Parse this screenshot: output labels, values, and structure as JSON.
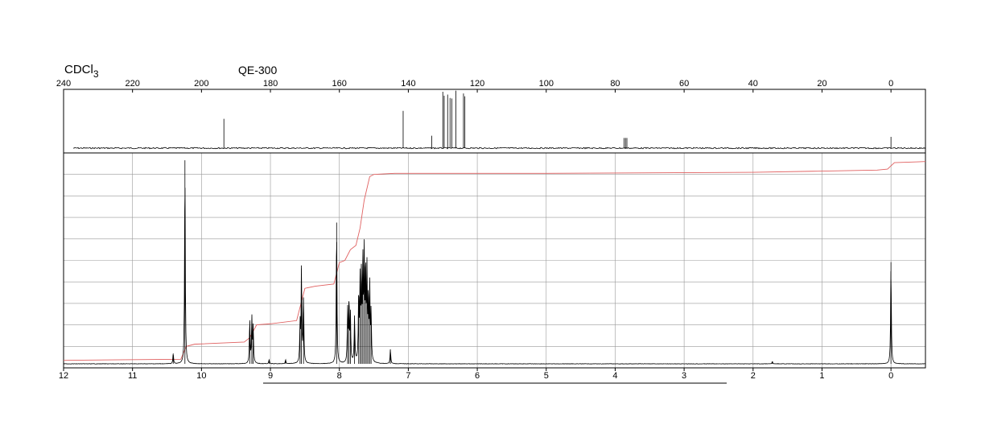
{
  "header": {
    "solvent": "CDCl",
    "solvent_subscript": "3",
    "instrument": "QE-300"
  },
  "colors": {
    "trace": "#000000",
    "integral": "#e06060",
    "grid": "#999999",
    "frame": "#000000"
  },
  "chart_data": [
    {
      "type": "line",
      "nucleus": "13C",
      "xlim": [
        240,
        -10
      ],
      "xticks": [
        240,
        220,
        200,
        180,
        160,
        140,
        120,
        100,
        80,
        60,
        40,
        20,
        0
      ],
      "xtick_labels": [
        "240",
        "220",
        "200",
        "180",
        "160",
        "140",
        "120",
        "100",
        "80",
        "60",
        "40",
        "20",
        "0"
      ],
      "grid": false,
      "peaks": [
        {
          "x": 193.5,
          "y": 0.52
        },
        {
          "x": 141.5,
          "y": 0.66
        },
        {
          "x": 133.2,
          "y": 0.22
        },
        {
          "x": 130.0,
          "y": 1.0
        },
        {
          "x": 129.6,
          "y": 0.93
        },
        {
          "x": 128.6,
          "y": 0.95
        },
        {
          "x": 127.9,
          "y": 0.89
        },
        {
          "x": 127.4,
          "y": 0.88
        },
        {
          "x": 126.2,
          "y": 1.02
        },
        {
          "x": 124.0,
          "y": 0.97
        },
        {
          "x": 123.6,
          "y": 0.92
        },
        {
          "x": 77.4,
          "y": 0.18
        },
        {
          "x": 77.0,
          "y": 0.18
        },
        {
          "x": 76.6,
          "y": 0.18
        },
        {
          "x": 0.0,
          "y": 0.2
        }
      ]
    },
    {
      "type": "line",
      "nucleus": "1H",
      "xlim": [
        12,
        -0.5
      ],
      "xticks": [
        12,
        11,
        10,
        9,
        8,
        7,
        6,
        5,
        4,
        3,
        2,
        1,
        0
      ],
      "xtick_labels": [
        "12",
        "11",
        "10",
        "9",
        "8",
        "7",
        "6",
        "5",
        "4",
        "3",
        "2",
        "1",
        "0"
      ],
      "ylim": [
        0,
        1
      ],
      "grid": true,
      "peaks": [
        {
          "x": 10.41,
          "y": 0.05
        },
        {
          "x": 10.24,
          "y": 0.98
        },
        {
          "x": 9.3,
          "y": 0.21
        },
        {
          "x": 9.27,
          "y": 0.22
        },
        {
          "x": 9.25,
          "y": 0.18
        },
        {
          "x": 9.02,
          "y": 0.02
        },
        {
          "x": 8.78,
          "y": 0.02
        },
        {
          "x": 8.57,
          "y": 0.19
        },
        {
          "x": 8.55,
          "y": 0.46
        },
        {
          "x": 8.52,
          "y": 0.32
        },
        {
          "x": 8.04,
          "y": 0.68
        },
        {
          "x": 7.88,
          "y": 0.25
        },
        {
          "x": 7.86,
          "y": 0.3
        },
        {
          "x": 7.84,
          "y": 0.23
        },
        {
          "x": 7.78,
          "y": 0.22
        },
        {
          "x": 7.72,
          "y": 0.33
        },
        {
          "x": 7.7,
          "y": 0.38
        },
        {
          "x": 7.68,
          "y": 0.41
        },
        {
          "x": 7.66,
          "y": 0.48
        },
        {
          "x": 7.64,
          "y": 0.5
        },
        {
          "x": 7.62,
          "y": 0.45
        },
        {
          "x": 7.6,
          "y": 0.42
        },
        {
          "x": 7.58,
          "y": 0.3
        },
        {
          "x": 7.56,
          "y": 0.36
        },
        {
          "x": 7.54,
          "y": 0.24
        },
        {
          "x": 7.26,
          "y": 0.07
        },
        {
          "x": 1.72,
          "y": 0.012
        },
        {
          "x": 0.0,
          "y": 0.49
        }
      ],
      "integral": [
        [
          12.0,
          0.035
        ],
        [
          10.3,
          0.04
        ],
        [
          10.22,
          0.1
        ],
        [
          10.1,
          0.11
        ],
        [
          9.38,
          0.12
        ],
        [
          9.3,
          0.14
        ],
        [
          9.2,
          0.2
        ],
        [
          9.0,
          0.205
        ],
        [
          8.62,
          0.22
        ],
        [
          8.5,
          0.37
        ],
        [
          8.35,
          0.38
        ],
        [
          8.08,
          0.39
        ],
        [
          8.0,
          0.49
        ],
        [
          7.92,
          0.5
        ],
        [
          7.84,
          0.55
        ],
        [
          7.76,
          0.57
        ],
        [
          7.7,
          0.65
        ],
        [
          7.64,
          0.78
        ],
        [
          7.56,
          0.89
        ],
        [
          7.5,
          0.9
        ],
        [
          7.2,
          0.905
        ],
        [
          5.0,
          0.905
        ],
        [
          2.0,
          0.91
        ],
        [
          0.2,
          0.92
        ],
        [
          0.05,
          0.925
        ],
        [
          -0.05,
          0.955
        ],
        [
          -0.5,
          0.96
        ]
      ]
    }
  ]
}
